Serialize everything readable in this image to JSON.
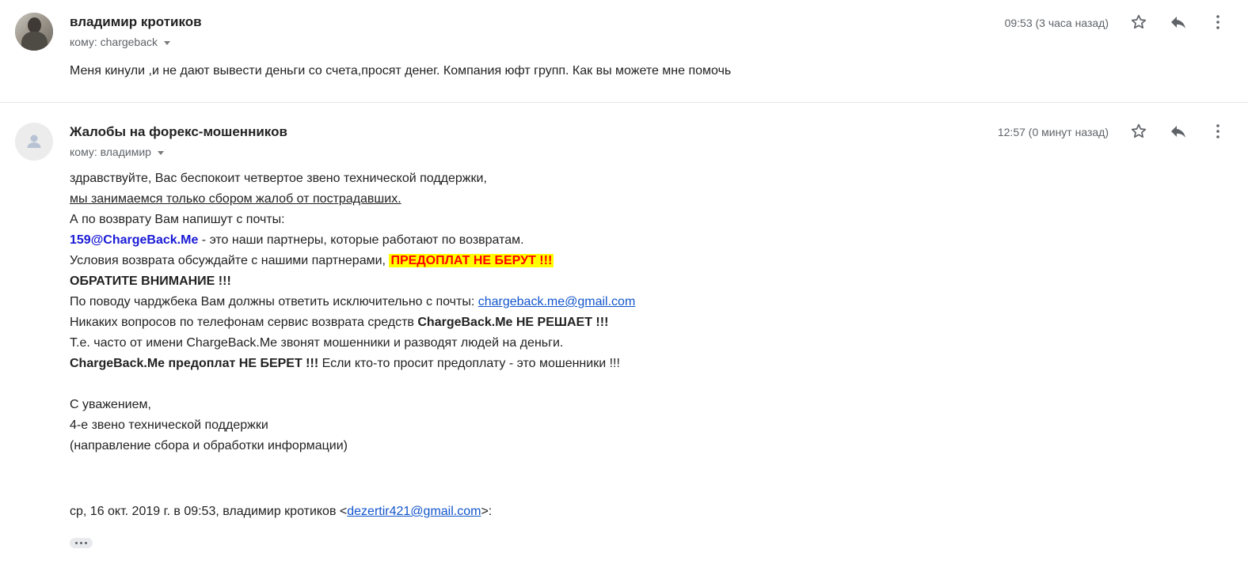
{
  "messages": [
    {
      "sender": "владимир кротиков",
      "to": "кому: chargeback",
      "time": "09:53 (3 часа назад)",
      "avatar": "user-photo",
      "body": "Меня кинули ,и не дают вывести деньги со счета,просят денег. Компания юфт групп. Как вы можете мне помочь"
    },
    {
      "sender": "Жалобы на форекс-мошенников",
      "to": "кому: владимир",
      "time": "12:57 (0 минут назад)",
      "avatar": "default-person-icon",
      "lines": {
        "l1": "здравствуйте, Вас беспокоит четвертое звено технической поддержки,",
        "l2": "мы занимаемся только сбором жалоб от пострадавших.",
        "l3": "А по возврату Вам напишут с почты:",
        "l4_email": "159@ChargeBack.Me",
        "l4_rest": " - это наши партнеры, которые работают по возвратам.",
        "l5_text": "Условия возврата обсуждайте с нашими партнерами, ",
        "l5_highlight": "ПРЕДОПЛАТ НЕ БЕРУТ !!!",
        "l6": "ОБРАТИТЕ ВНИМАНИЕ !!!",
        "l7_text": "По поводу чарджбека Вам должны ответить исключительно с почты: ",
        "l7_link": "chargeback.me@gmail.com",
        "l8_text": "Никаких вопросов по телефонам сервис возврата средств ",
        "l8_bold": "ChargeBack.Me НЕ РЕШАЕТ !!!",
        "l9": "Т.е. часто от имени ChargeBack.Me звонят мошенники и разводят людей на деньги.",
        "l10_bold": "ChargeBack.Me предоплат НЕ БЕРЕТ !!!",
        "l10_rest": " Если кто-то просит предоплату - это мошенники !!!",
        "sig1": "С уважением,",
        "sig2": "4-е звено технической поддержки",
        "sig3": "(направление сбора и обработки информации)"
      },
      "quote_header_prefix": "ср, 16 окт. 2019 г. в 09:53, владимир кротиков <",
      "quote_header_email": "dezertir421@gmail.com",
      "quote_header_suffix": ">:"
    }
  ],
  "icons": {
    "star": "star-outline-icon",
    "reply": "reply-icon",
    "more": "more-vert-icon",
    "expand": "show-trimmed-content-icon"
  },
  "colors": {
    "link": "#1155cc",
    "email_bold": "#1a1ad6",
    "highlight_bg": "#ffff00",
    "highlight_fg": "#ff0000",
    "meta": "#5f6368"
  }
}
